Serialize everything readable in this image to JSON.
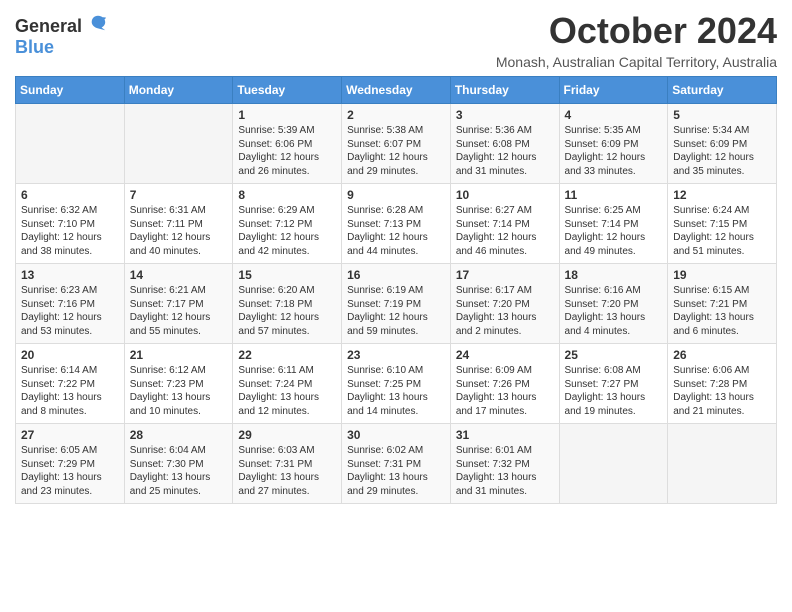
{
  "logo": {
    "general": "General",
    "blue": "Blue"
  },
  "title": "October 2024",
  "subtitle": "Monash, Australian Capital Territory, Australia",
  "days_of_week": [
    "Sunday",
    "Monday",
    "Tuesday",
    "Wednesday",
    "Thursday",
    "Friday",
    "Saturday"
  ],
  "weeks": [
    [
      {
        "day": "",
        "info": ""
      },
      {
        "day": "",
        "info": ""
      },
      {
        "day": "1",
        "info": "Sunrise: 5:39 AM\nSunset: 6:06 PM\nDaylight: 12 hours\nand 26 minutes."
      },
      {
        "day": "2",
        "info": "Sunrise: 5:38 AM\nSunset: 6:07 PM\nDaylight: 12 hours\nand 29 minutes."
      },
      {
        "day": "3",
        "info": "Sunrise: 5:36 AM\nSunset: 6:08 PM\nDaylight: 12 hours\nand 31 minutes."
      },
      {
        "day": "4",
        "info": "Sunrise: 5:35 AM\nSunset: 6:09 PM\nDaylight: 12 hours\nand 33 minutes."
      },
      {
        "day": "5",
        "info": "Sunrise: 5:34 AM\nSunset: 6:09 PM\nDaylight: 12 hours\nand 35 minutes."
      }
    ],
    [
      {
        "day": "6",
        "info": "Sunrise: 6:32 AM\nSunset: 7:10 PM\nDaylight: 12 hours\nand 38 minutes."
      },
      {
        "day": "7",
        "info": "Sunrise: 6:31 AM\nSunset: 7:11 PM\nDaylight: 12 hours\nand 40 minutes."
      },
      {
        "day": "8",
        "info": "Sunrise: 6:29 AM\nSunset: 7:12 PM\nDaylight: 12 hours\nand 42 minutes."
      },
      {
        "day": "9",
        "info": "Sunrise: 6:28 AM\nSunset: 7:13 PM\nDaylight: 12 hours\nand 44 minutes."
      },
      {
        "day": "10",
        "info": "Sunrise: 6:27 AM\nSunset: 7:14 PM\nDaylight: 12 hours\nand 46 minutes."
      },
      {
        "day": "11",
        "info": "Sunrise: 6:25 AM\nSunset: 7:14 PM\nDaylight: 12 hours\nand 49 minutes."
      },
      {
        "day": "12",
        "info": "Sunrise: 6:24 AM\nSunset: 7:15 PM\nDaylight: 12 hours\nand 51 minutes."
      }
    ],
    [
      {
        "day": "13",
        "info": "Sunrise: 6:23 AM\nSunset: 7:16 PM\nDaylight: 12 hours\nand 53 minutes."
      },
      {
        "day": "14",
        "info": "Sunrise: 6:21 AM\nSunset: 7:17 PM\nDaylight: 12 hours\nand 55 minutes."
      },
      {
        "day": "15",
        "info": "Sunrise: 6:20 AM\nSunset: 7:18 PM\nDaylight: 12 hours\nand 57 minutes."
      },
      {
        "day": "16",
        "info": "Sunrise: 6:19 AM\nSunset: 7:19 PM\nDaylight: 12 hours\nand 59 minutes."
      },
      {
        "day": "17",
        "info": "Sunrise: 6:17 AM\nSunset: 7:20 PM\nDaylight: 13 hours\nand 2 minutes."
      },
      {
        "day": "18",
        "info": "Sunrise: 6:16 AM\nSunset: 7:20 PM\nDaylight: 13 hours\nand 4 minutes."
      },
      {
        "day": "19",
        "info": "Sunrise: 6:15 AM\nSunset: 7:21 PM\nDaylight: 13 hours\nand 6 minutes."
      }
    ],
    [
      {
        "day": "20",
        "info": "Sunrise: 6:14 AM\nSunset: 7:22 PM\nDaylight: 13 hours\nand 8 minutes."
      },
      {
        "day": "21",
        "info": "Sunrise: 6:12 AM\nSunset: 7:23 PM\nDaylight: 13 hours\nand 10 minutes."
      },
      {
        "day": "22",
        "info": "Sunrise: 6:11 AM\nSunset: 7:24 PM\nDaylight: 13 hours\nand 12 minutes."
      },
      {
        "day": "23",
        "info": "Sunrise: 6:10 AM\nSunset: 7:25 PM\nDaylight: 13 hours\nand 14 minutes."
      },
      {
        "day": "24",
        "info": "Sunrise: 6:09 AM\nSunset: 7:26 PM\nDaylight: 13 hours\nand 17 minutes."
      },
      {
        "day": "25",
        "info": "Sunrise: 6:08 AM\nSunset: 7:27 PM\nDaylight: 13 hours\nand 19 minutes."
      },
      {
        "day": "26",
        "info": "Sunrise: 6:06 AM\nSunset: 7:28 PM\nDaylight: 13 hours\nand 21 minutes."
      }
    ],
    [
      {
        "day": "27",
        "info": "Sunrise: 6:05 AM\nSunset: 7:29 PM\nDaylight: 13 hours\nand 23 minutes."
      },
      {
        "day": "28",
        "info": "Sunrise: 6:04 AM\nSunset: 7:30 PM\nDaylight: 13 hours\nand 25 minutes."
      },
      {
        "day": "29",
        "info": "Sunrise: 6:03 AM\nSunset: 7:31 PM\nDaylight: 13 hours\nand 27 minutes."
      },
      {
        "day": "30",
        "info": "Sunrise: 6:02 AM\nSunset: 7:31 PM\nDaylight: 13 hours\nand 29 minutes."
      },
      {
        "day": "31",
        "info": "Sunrise: 6:01 AM\nSunset: 7:32 PM\nDaylight: 13 hours\nand 31 minutes."
      },
      {
        "day": "",
        "info": ""
      },
      {
        "day": "",
        "info": ""
      }
    ]
  ]
}
